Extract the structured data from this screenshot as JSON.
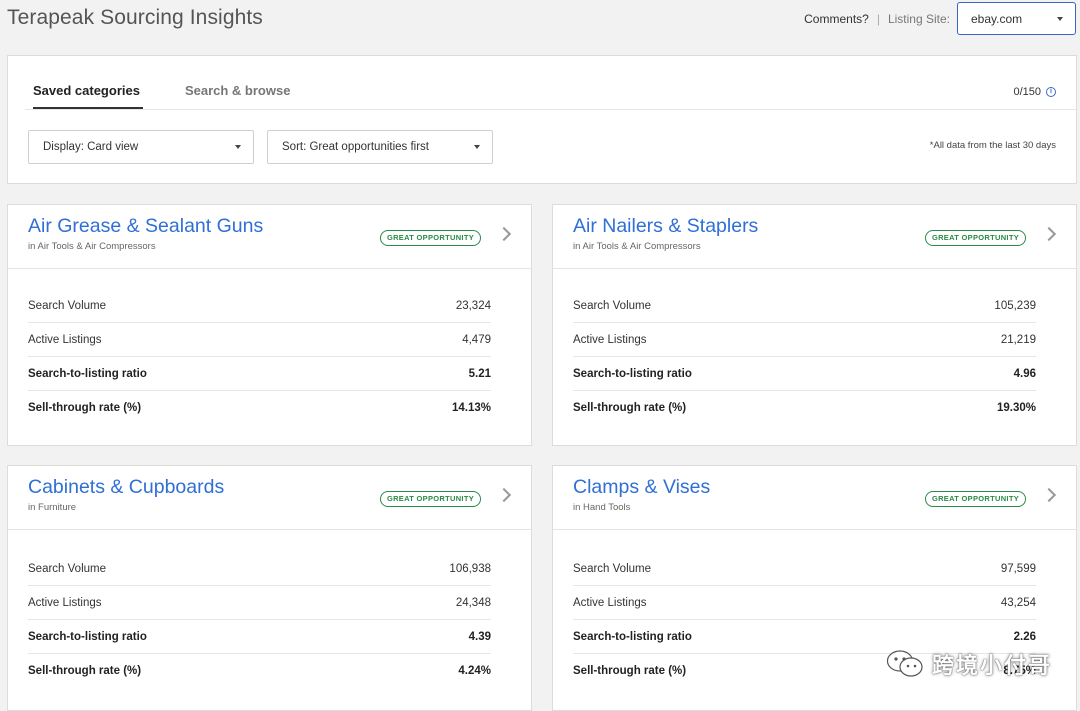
{
  "header": {
    "title": "Terapeak Sourcing Insights",
    "comments": "Comments?",
    "separator": "|",
    "listing_site_label": "Listing Site:",
    "listing_site_value": "ebay.com"
  },
  "toolbar": {
    "tabs": [
      {
        "label": "Saved categories",
        "active": true
      },
      {
        "label": "Search & browse",
        "active": false
      }
    ],
    "counter": "0/150",
    "display_dropdown": "Display: Card view",
    "sort_dropdown": "Sort: Great opportunities first",
    "data_note": "*All data from the last 30 days"
  },
  "badge_label": "GREAT OPPORTUNITY",
  "cards": [
    {
      "title": "Air Grease & Sealant Guns",
      "subtitle": "in Air Tools & Air Compressors",
      "metrics": [
        {
          "label": "Search Volume",
          "value": "23,324"
        },
        {
          "label": "Active Listings",
          "value": "4,479"
        },
        {
          "label": "Search-to-listing ratio",
          "value": "5.21"
        },
        {
          "label": "Sell-through rate (%)",
          "value": "14.13%"
        }
      ]
    },
    {
      "title": "Air Nailers & Staplers",
      "subtitle": "in Air Tools & Air Compressors",
      "metrics": [
        {
          "label": "Search Volume",
          "value": "105,239"
        },
        {
          "label": "Active Listings",
          "value": "21,219"
        },
        {
          "label": "Search-to-listing ratio",
          "value": "4.96"
        },
        {
          "label": "Sell-through rate (%)",
          "value": "19.30%"
        }
      ]
    },
    {
      "title": "Cabinets & Cupboards",
      "subtitle": "in Furniture",
      "metrics": [
        {
          "label": "Search Volume",
          "value": "106,938"
        },
        {
          "label": "Active Listings",
          "value": "24,348"
        },
        {
          "label": "Search-to-listing ratio",
          "value": "4.39"
        },
        {
          "label": "Sell-through rate (%)",
          "value": "4.24%"
        }
      ]
    },
    {
      "title": "Clamps & Vises",
      "subtitle": "in Hand Tools",
      "metrics": [
        {
          "label": "Search Volume",
          "value": "97,599"
        },
        {
          "label": "Active Listings",
          "value": "43,254"
        },
        {
          "label": "Search-to-listing ratio",
          "value": "2.26"
        },
        {
          "label": "Sell-through rate (%)",
          "value": "8.75%"
        }
      ]
    }
  ],
  "watermark": "跨境小付哥",
  "colors": {
    "link_blue": "#2f6fd6",
    "badge_green": "#2a8a47",
    "select_border": "#3665c4"
  }
}
